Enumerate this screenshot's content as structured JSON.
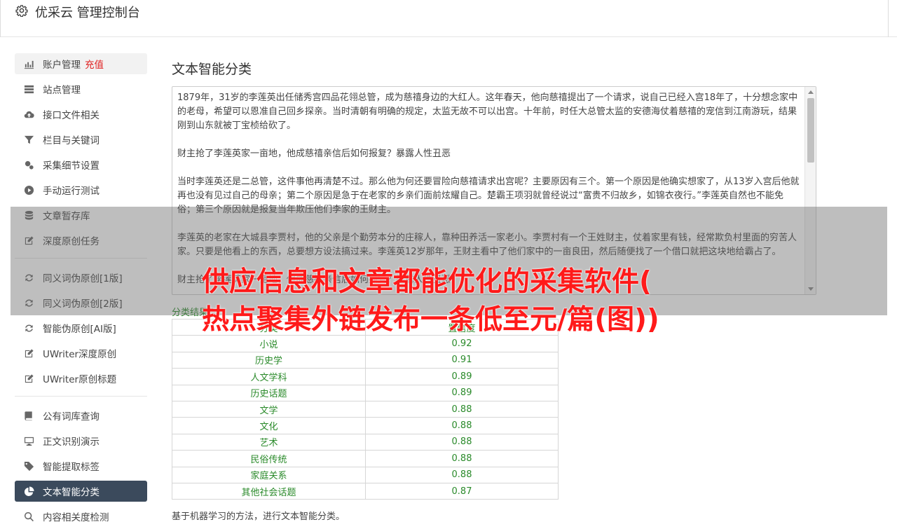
{
  "header": {
    "title": "优采云 管理控制台",
    "icon": "gear-icon"
  },
  "sidebar": {
    "groups": [
      [
        {
          "label": "账户管理",
          "extra": "充值",
          "icon": "bar-chart-icon",
          "name": "sidebar-item-account"
        },
        {
          "label": "站点管理",
          "icon": "server-icon",
          "name": "sidebar-item-sites"
        },
        {
          "label": "接口文件相关",
          "icon": "cloud-upload-icon",
          "name": "sidebar-item-api-files"
        },
        {
          "label": "栏目与关键词",
          "icon": "filter-icon",
          "name": "sidebar-item-columns-keywords"
        },
        {
          "label": "采集细节设置",
          "icon": "gears-icon",
          "name": "sidebar-item-collect-settings"
        },
        {
          "label": "手动运行测试",
          "icon": "play-circle-icon",
          "name": "sidebar-item-manual-run"
        },
        {
          "label": "文章暂存库",
          "icon": "database-icon",
          "name": "sidebar-item-article-store"
        },
        {
          "label": "深度原创任务",
          "icon": "edit-icon",
          "name": "sidebar-item-deep-original"
        }
      ],
      [
        {
          "label": "同义词伪原创[1版]",
          "icon": "refresh-icon",
          "name": "sidebar-item-synonym-v1"
        },
        {
          "label": "同义词伪原创[2版]",
          "icon": "refresh-icon",
          "name": "sidebar-item-synonym-v2"
        },
        {
          "label": "智能伪原创[AI版]",
          "icon": "refresh-icon",
          "name": "sidebar-item-ai-rewrite"
        },
        {
          "label": "UWriter深度原创",
          "icon": "edit-icon",
          "name": "sidebar-item-uwriter-deep"
        },
        {
          "label": "UWriter原创标题",
          "icon": "edit-icon",
          "name": "sidebar-item-uwriter-title"
        }
      ],
      [
        {
          "label": "公有词库查询",
          "icon": "book-icon",
          "name": "sidebar-item-public-lexicon"
        },
        {
          "label": "正文识别演示",
          "icon": "monitor-icon",
          "name": "sidebar-item-text-recognition"
        },
        {
          "label": "智能提取标签",
          "icon": "tag-icon",
          "name": "sidebar-item-tag-extract"
        },
        {
          "label": "文本智能分类",
          "icon": "pie-chart-icon",
          "name": "sidebar-item-text-classify",
          "active": true
        },
        {
          "label": "内容相关度检测",
          "icon": "search-icon",
          "name": "sidebar-item-relevance"
        }
      ]
    ]
  },
  "main": {
    "title": "文本智能分类",
    "text_paragraphs": [
      "1879年，31岁的李莲英出任储秀宫四品花翎总管，成为慈禧身边的大红人。这年春天，他向慈禧提出了一个请求，说自己已经入宫18年了，十分想念家中的老母，希望可以恩准自己回乡探亲。当时清朝有明确的规定，太监无故不可以出宫。十年前，时任大总管太监的安德海仗着慈禧的宠信到江南游玩，结果刚到山东就被丁宝桢给砍了。",
      "财主抢了李莲英家一亩地，他成慈禧亲信后如何报复？暴露人性丑恶",
      "当时李莲英还是二总管，这件事他再清楚不过。那么他为何还要冒险向慈禧请求出宫呢？主要原因有三个。第一个原因是他确实想家了，从13岁入宫后他就再也没有见过自己的母亲；第二个原因是急于在老家的乡亲们面前炫耀自己。楚霸王项羽就曾经说过“富贵不归故乡，如锦衣夜行。”李莲英自然也不能免俗；第三个原因就是报复当年欺压他们李家的王财主。",
      "李莲英的老家在大城县李贾村，他的父亲是个勤劳本分的庄稼人，靠种田养活一家老小。李贾村有一个王姓财主，仗着家里有钱，经常欺负村里面的穷苦人家。只要是他看上的东西，总要想方设法搞过来。李莲英12岁那年，王财主看中了他们家中的一亩良田，然后随便找了一个借口就把这块地给霸占了。",
      "财主抢了李莲英家一亩地，他成慈禧亲信后如何报复？暴露人性丑恶"
    ],
    "result_label": "分类结果",
    "table": {
      "headers": [
        "分类",
        "置信度"
      ],
      "rows": [
        [
          "小说",
          "0.92"
        ],
        [
          "历史学",
          "0.91"
        ],
        [
          "人文学科",
          "0.89"
        ],
        [
          "历史话题",
          "0.89"
        ],
        [
          "文学",
          "0.88"
        ],
        [
          "文化",
          "0.88"
        ],
        [
          "艺术",
          "0.88"
        ],
        [
          "民俗传统",
          "0.88"
        ],
        [
          "家庭关系",
          "0.88"
        ],
        [
          "其他社会话题",
          "0.87"
        ]
      ]
    },
    "note": "基于机器学习的方法，进行文本智能分类。"
  },
  "overlay": {
    "line1": "供应信息和文章都能优化的采集软件(",
    "line2": "热点聚集外链发布一条低至元/篇(图))"
  },
  "colors": {
    "accent_red": "#e02020",
    "active_bg": "#3b4a5c",
    "result_green": "#2a8a2a",
    "overlay_text": "#ff1a1a"
  }
}
